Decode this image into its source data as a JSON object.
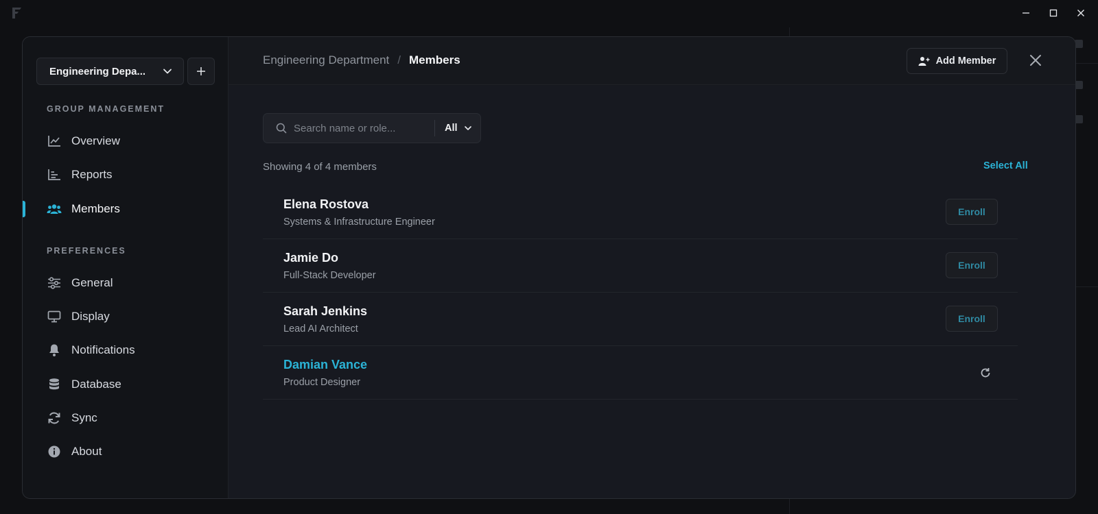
{
  "workspace": {
    "name": "Engineering Depa..."
  },
  "sidebar": {
    "group_label": "GROUP MANAGEMENT",
    "group_items": [
      {
        "label": "Overview",
        "icon": "chart-line-icon"
      },
      {
        "label": "Reports",
        "icon": "bar-chart-icon"
      },
      {
        "label": "Members",
        "icon": "users-icon",
        "active": true
      }
    ],
    "prefs_label": "PREFERENCES",
    "pref_items": [
      {
        "label": "General",
        "icon": "sliders-icon"
      },
      {
        "label": "Display",
        "icon": "monitor-icon"
      },
      {
        "label": "Notifications",
        "icon": "bell-icon"
      },
      {
        "label": "Database",
        "icon": "database-icon"
      },
      {
        "label": "Sync",
        "icon": "sync-icon"
      },
      {
        "label": "About",
        "icon": "info-icon"
      }
    ]
  },
  "header": {
    "breadcrumb_parent": "Engineering Department",
    "breadcrumb_sep": "/",
    "breadcrumb_current": "Members",
    "add_member_label": "Add Member"
  },
  "search": {
    "placeholder": "Search name or role...",
    "filter_value": "All"
  },
  "list": {
    "showing_text": "Showing 4 of 4 members",
    "select_all_label": "Select All",
    "members": [
      {
        "name": "Elena Rostova",
        "role": "Systems & Infrastructure Engineer",
        "action": "Enroll"
      },
      {
        "name": "Jamie Do",
        "role": "Full-Stack Developer",
        "action": "Enroll"
      },
      {
        "name": "Sarah Jenkins",
        "role": "Lead AI Architect",
        "action": "Enroll"
      },
      {
        "name": "Damian Vance",
        "role": "Product Designer",
        "action": "refresh"
      }
    ]
  },
  "colors": {
    "accent": "#2bb3d6",
    "background": "#0f1013",
    "panel": "#16181d"
  }
}
